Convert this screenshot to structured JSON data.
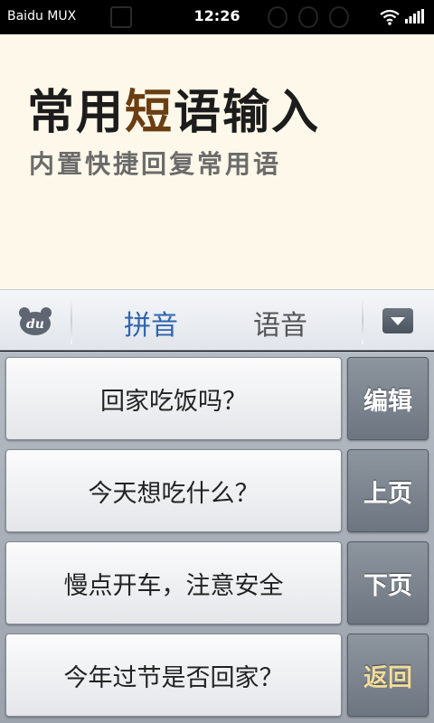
{
  "status_bar": {
    "carrier": "Baidu MUX",
    "time": "12:26"
  },
  "banner": {
    "title_part1": "常用",
    "title_accent": "短",
    "title_part2": "语输入",
    "subtitle": "内置快捷回复常用语"
  },
  "toolbar": {
    "logo_text": "du",
    "tabs": [
      {
        "label": "拼音",
        "selected": true
      },
      {
        "label": "语音",
        "selected": false
      }
    ]
  },
  "phrases": [
    "回家吃饭吗？",
    "今天想吃什么？",
    "慢点开车，注意安全",
    "今年过节是否回家？"
  ],
  "side_buttons": {
    "edit": "编辑",
    "prev_page": "上页",
    "next_page": "下页",
    "back": "返回"
  },
  "colors": {
    "banner_bg": "#fdf8e9",
    "selected_tab": "#2f65b0",
    "back_label": "#f2dc9a"
  }
}
